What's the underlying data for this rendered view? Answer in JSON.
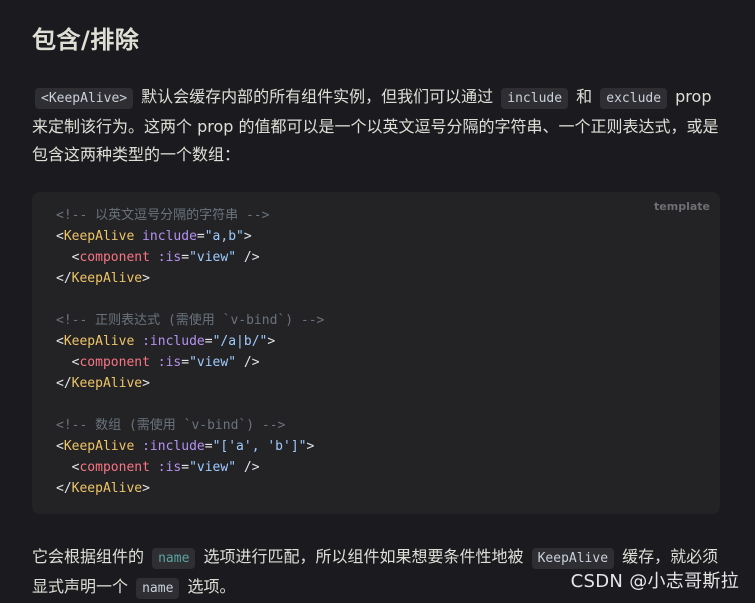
{
  "heading": "包含/排除",
  "intro": {
    "code1": "<KeepAlive>",
    "text1": " 默认会缓存内部的所有组件实例，但我们可以通过 ",
    "code2": "include",
    "text2": " 和 ",
    "code3": "exclude",
    "text3": " prop 来定制该行为。这两个 prop 的值都可以是一个以英文逗号分隔的字符串、一个正则表达式，或是包含这两种类型的一个数组："
  },
  "code_block": {
    "language": "template",
    "lines": [
      [
        {
          "t": "<!-- 以英文逗号分隔的字符串 -->",
          "c": "comment"
        }
      ],
      [
        {
          "t": "<",
          "c": "bracket"
        },
        {
          "t": "KeepAlive",
          "c": "tag"
        },
        {
          "t": " include",
          "c": "attr"
        },
        {
          "t": "=",
          "c": "bracket"
        },
        {
          "t": "\"a,b\"",
          "c": "str"
        },
        {
          "t": ">",
          "c": "bracket"
        }
      ],
      [
        {
          "t": "  <",
          "c": "bracket"
        },
        {
          "t": "component",
          "c": "tag2"
        },
        {
          "t": " :is",
          "c": "attr"
        },
        {
          "t": "=",
          "c": "bracket"
        },
        {
          "t": "\"view\"",
          "c": "str"
        },
        {
          "t": " />",
          "c": "bracket"
        }
      ],
      [
        {
          "t": "</",
          "c": "bracket"
        },
        {
          "t": "KeepAlive",
          "c": "tag"
        },
        {
          "t": ">",
          "c": "bracket"
        }
      ],
      [],
      [
        {
          "t": "<!-- 正则表达式 (需使用 `v-bind`) -->",
          "c": "comment"
        }
      ],
      [
        {
          "t": "<",
          "c": "bracket"
        },
        {
          "t": "KeepAlive",
          "c": "tag"
        },
        {
          "t": " :include",
          "c": "attr"
        },
        {
          "t": "=",
          "c": "bracket"
        },
        {
          "t": "\"/a|b/\"",
          "c": "str"
        },
        {
          "t": ">",
          "c": "bracket"
        }
      ],
      [
        {
          "t": "  <",
          "c": "bracket"
        },
        {
          "t": "component",
          "c": "tag2"
        },
        {
          "t": " :is",
          "c": "attr"
        },
        {
          "t": "=",
          "c": "bracket"
        },
        {
          "t": "\"view\"",
          "c": "str"
        },
        {
          "t": " />",
          "c": "bracket"
        }
      ],
      [
        {
          "t": "</",
          "c": "bracket"
        },
        {
          "t": "KeepAlive",
          "c": "tag"
        },
        {
          "t": ">",
          "c": "bracket"
        }
      ],
      [],
      [
        {
          "t": "<!-- 数组 (需使用 `v-bind`) -->",
          "c": "comment"
        }
      ],
      [
        {
          "t": "<",
          "c": "bracket"
        },
        {
          "t": "KeepAlive",
          "c": "tag"
        },
        {
          "t": " :include",
          "c": "attr"
        },
        {
          "t": "=",
          "c": "bracket"
        },
        {
          "t": "\"['a', 'b']\"",
          "c": "str"
        },
        {
          "t": ">",
          "c": "bracket"
        }
      ],
      [
        {
          "t": "  <",
          "c": "bracket"
        },
        {
          "t": "component",
          "c": "tag2"
        },
        {
          "t": " :is",
          "c": "attr"
        },
        {
          "t": "=",
          "c": "bracket"
        },
        {
          "t": "\"view\"",
          "c": "str"
        },
        {
          "t": " />",
          "c": "bracket"
        }
      ],
      [
        {
          "t": "</",
          "c": "bracket"
        },
        {
          "t": "KeepAlive",
          "c": "tag"
        },
        {
          "t": ">",
          "c": "bracket"
        }
      ]
    ]
  },
  "outro": {
    "text1": "它会根据组件的 ",
    "code1": "name",
    "text2": " 选项进行匹配，所以组件如果想要条件性地被 ",
    "code2": "KeepAlive",
    "text3": " 缓存，就必须显式声明一个 ",
    "code3": "name",
    "text4": " 选项。"
  },
  "watermark": "CSDN @小志哥斯拉",
  "colors": {
    "background": "#1b1b1f",
    "code_background": "#232326",
    "inline_code_background": "#2e2e33"
  }
}
